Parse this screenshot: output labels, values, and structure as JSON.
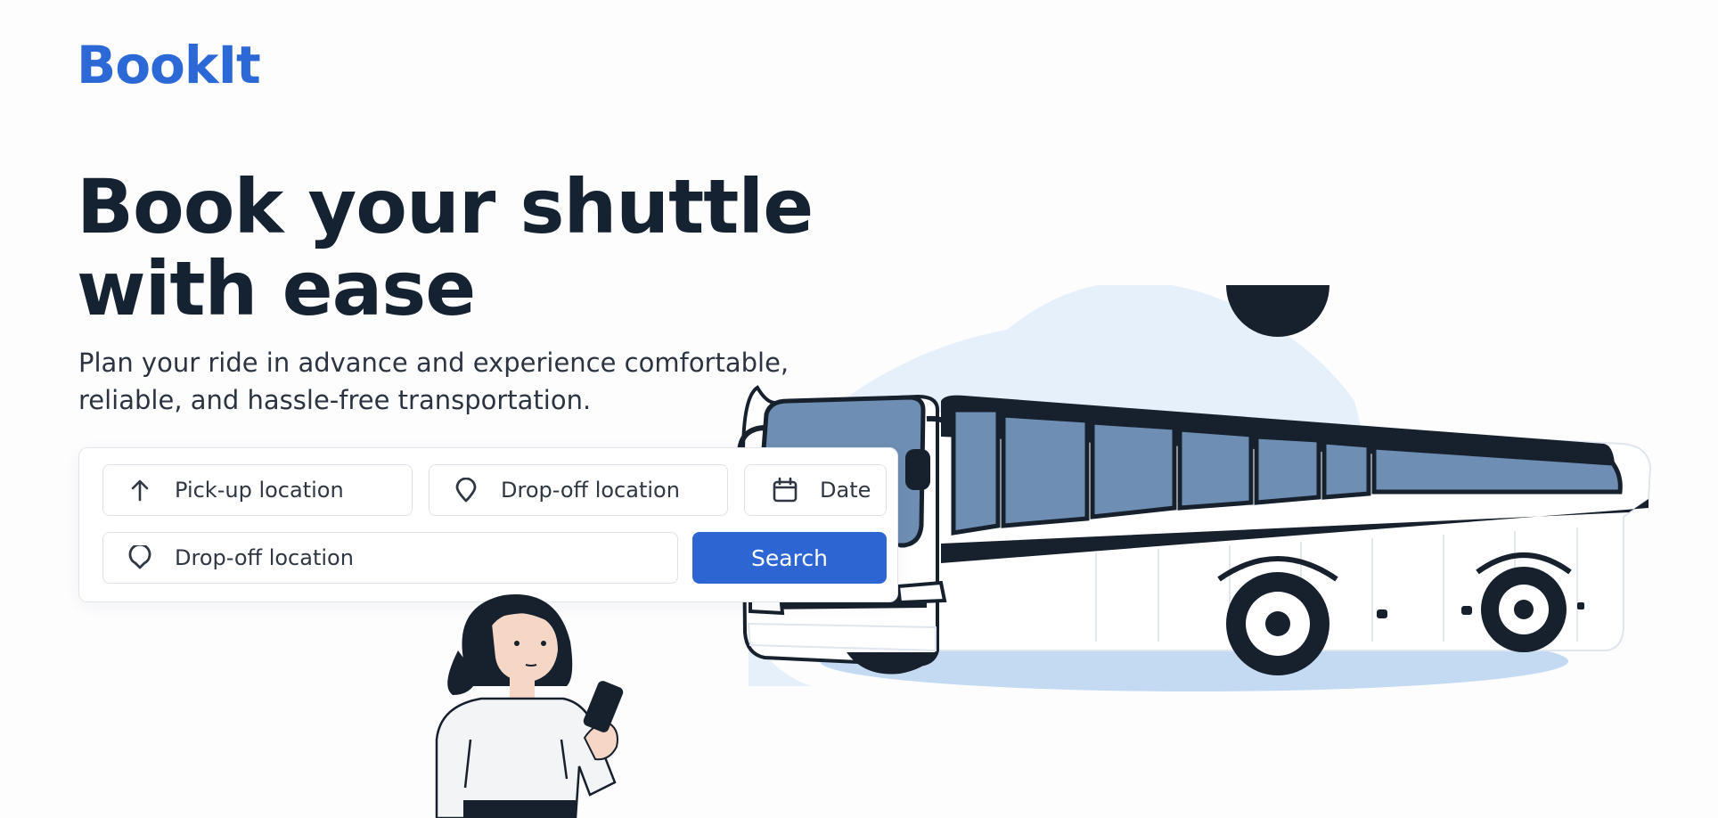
{
  "brand": {
    "logo_text": "BookIt",
    "accent_color": "#2c69d6"
  },
  "hero": {
    "headline_line1": "Book your shuttle",
    "headline_line2": "with ease",
    "subhead_line1": "Plan your ride in advance and experience comfortable,",
    "subhead_line2": "reliable, and hassle-free transportation."
  },
  "search_form": {
    "pickup": {
      "label": "Pick-up location",
      "icon": "arrow-up-icon"
    },
    "dropoff_primary": {
      "label": "Drop-off location",
      "icon": "map-pin-icon"
    },
    "date": {
      "label": "Date",
      "icon": "calendar-icon"
    },
    "dropoff_secondary": {
      "label": "Drop-off location",
      "icon": "map-pin-icon"
    },
    "search_button_label": "Search",
    "button_color": "#2d66d3"
  },
  "illustrations": {
    "bus": "bus-illustration",
    "person": "woman-with-phone-illustration"
  }
}
